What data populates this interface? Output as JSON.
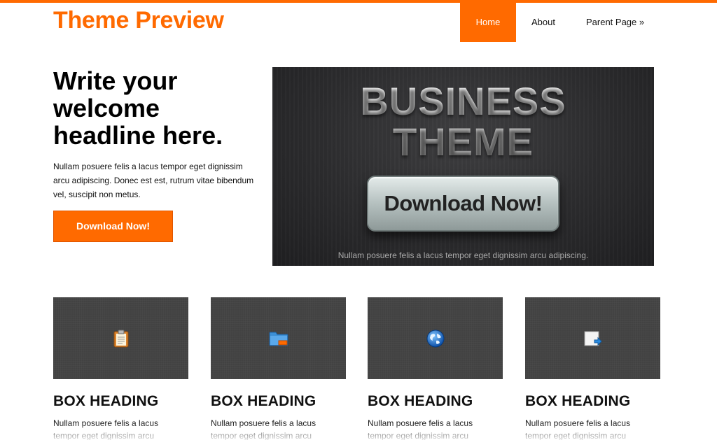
{
  "site": {
    "title": "Theme Preview",
    "accent_color": "#ff6a00"
  },
  "nav": {
    "items": [
      {
        "label": "Home",
        "active": true
      },
      {
        "label": "About",
        "active": false
      },
      {
        "label": "Parent Page »",
        "active": false
      }
    ]
  },
  "hero": {
    "headline": "Write your welcome headline here.",
    "text": "Nullam posuere felis a lacus tempor eget dignissim arcu adipiscing. Donec est est, rutrum vitae bibendum vel, suscipit non metus.",
    "cta_label": "Download Now!"
  },
  "banner": {
    "title_line1": "BUSINESS",
    "title_line2": "THEME",
    "button_label": "Download Now!",
    "caption": "Nullam posuere felis a lacus tempor eget dignissim arcu adipiscing."
  },
  "boxes": [
    {
      "icon": "clipboard-icon",
      "heading": "BOX HEADING",
      "text": "Nullam posuere felis a lacus tempor eget dignissim arcu"
    },
    {
      "icon": "folder-icon",
      "heading": "BOX HEADING",
      "text": "Nullam posuere felis a lacus tempor eget dignissim arcu"
    },
    {
      "icon": "globe-icon",
      "heading": "BOX HEADING",
      "text": "Nullam posuere felis a lacus tempor eget dignissim arcu"
    },
    {
      "icon": "document-arrow-icon",
      "heading": "BOX HEADING",
      "text": "Nullam posuere felis a lacus tempor eget dignissim arcu"
    }
  ]
}
